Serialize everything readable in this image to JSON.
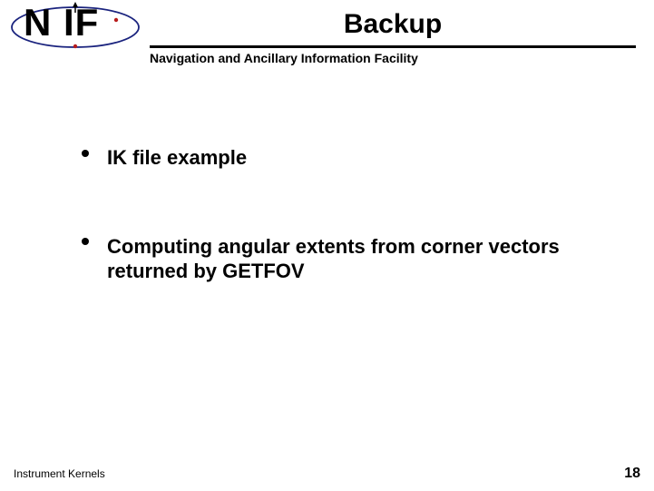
{
  "logo": {
    "text": "N IF"
  },
  "title": "Backup",
  "subtitle": "Navigation and Ancillary Information Facility",
  "bullets": [
    "IK file example",
    "Computing angular extents from corner vectors returned by GETFOV"
  ],
  "footer": {
    "left": "Instrument Kernels",
    "page": "18"
  }
}
